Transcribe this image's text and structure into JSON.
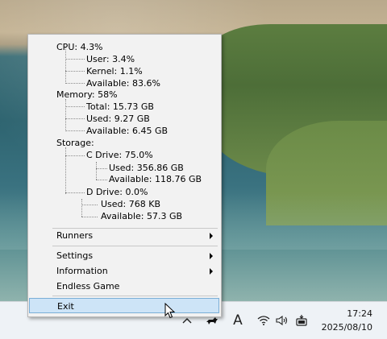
{
  "stats": {
    "cpu": "CPU: 4.3%",
    "cpu_user": "User: 3.4%",
    "cpu_kernel": "Kernel: 1.1%",
    "cpu_available": "Available: 83.6%",
    "memory": "Memory: 58%",
    "mem_total": "Total: 15.73 GB",
    "mem_used": "Used: 9.27 GB",
    "mem_available": "Available: 6.45 GB",
    "storage": "Storage:",
    "c_drive": "C Drive: 75.0%",
    "c_used": "Used: 356.86 GB",
    "c_available": "Available: 118.76 GB",
    "d_drive": "D Drive: 0.0%",
    "d_used": "Used: 768 KB",
    "d_available": "Available: 57.3 GB"
  },
  "menu": {
    "runners": "Runners",
    "settings": "Settings",
    "information": "Information",
    "endless_game": "Endless Game",
    "exit": "Exit"
  },
  "taskbar": {
    "time": "17:24",
    "date": "2025/08/10",
    "ime_indicator": "A",
    "icons": [
      "chevron-up-icon",
      "cat-runner-icon",
      "wifi-icon",
      "speaker-icon",
      "battery-icon"
    ]
  }
}
